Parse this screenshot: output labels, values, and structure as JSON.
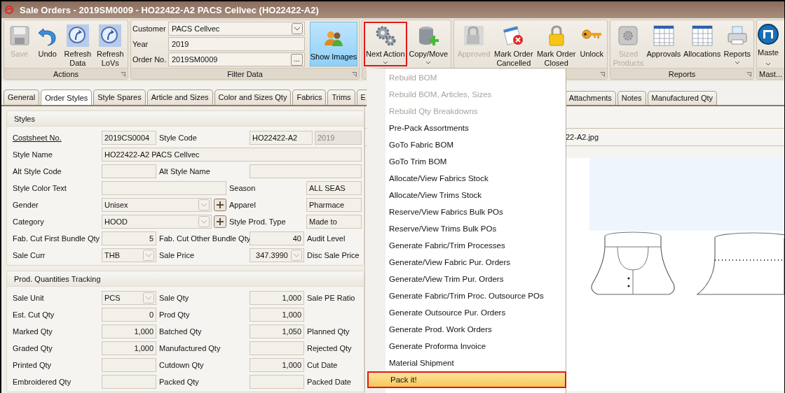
{
  "window": {
    "title": "Sale Orders - 2019SM0009 - HO22422-A2 PACS Cellvec (HO22422-A2)"
  },
  "ribbon": [
    {
      "kind": "buttons",
      "label": "Actions",
      "launcher": true,
      "buttons": [
        {
          "label": "Save",
          "kind": "save",
          "disabled": true,
          "dropdown": false,
          "outlined": false
        },
        {
          "label": "Undo",
          "kind": "undo",
          "disabled": false,
          "dropdown": false,
          "outlined": false
        },
        {
          "label": "Refresh\nData",
          "kind": "refresh",
          "disabled": false,
          "dropdown": false,
          "outlined": false
        },
        {
          "label": "Refresh\nLoVs",
          "kind": "refresh",
          "disabled": false,
          "dropdown": false,
          "outlined": false
        }
      ]
    },
    {
      "kind": "filter",
      "label": "Filter Data",
      "launcher": true,
      "fields": [
        {
          "label": "Customer",
          "value": "PACS Cellvec",
          "kind": "combo"
        },
        {
          "label": "Year",
          "value": "2019",
          "kind": "text"
        },
        {
          "label": "Order No.",
          "value": "2019SM0009",
          "kind": "ellipsis",
          "button": "..."
        }
      ],
      "show_button": {
        "label": "Show Images",
        "kind": "people"
      }
    },
    {
      "kind": "buttons",
      "launcher": false,
      "buttons": [
        {
          "label": "Next Action",
          "kind": "gears",
          "disabled": false,
          "dropdown": true,
          "outlined": true
        },
        {
          "label": "Copy/Move",
          "kind": "database",
          "disabled": false,
          "dropdown": true,
          "outlined": false
        }
      ]
    },
    {
      "kind": "buttons",
      "launcher": true,
      "buttons": [
        {
          "label": "Approved",
          "kind": "padlock-grey",
          "disabled": true,
          "dropdown": false,
          "outlined": false
        },
        {
          "label": "Mark Order\nCancelled",
          "kind": "calendar-cancel",
          "disabled": false,
          "dropdown": false,
          "outlined": false
        },
        {
          "label": "Mark Order\nClosed",
          "kind": "padlock",
          "disabled": false,
          "dropdown": false,
          "outlined": false
        },
        {
          "label": "Unlock",
          "kind": "key",
          "disabled": false,
          "dropdown": false,
          "outlined": false
        }
      ]
    },
    {
      "kind": "buttons",
      "label": "Reports",
      "launcher": true,
      "buttons": [
        {
          "label": "Sized\nProducts",
          "kind": "gear-box",
          "disabled": true,
          "dropdown": false,
          "outlined": false
        },
        {
          "label": "Approvals",
          "kind": "grid",
          "disabled": false,
          "dropdown": false,
          "outlined": false
        },
        {
          "label": "Allocations",
          "kind": "grid",
          "disabled": false,
          "dropdown": false,
          "outlined": false
        },
        {
          "label": "Reports",
          "kind": "printer",
          "disabled": false,
          "dropdown": true,
          "outlined": false
        }
      ]
    },
    {
      "kind": "buttons",
      "label": "Mast...",
      "launcher": false,
      "buttons": [
        {
          "label": "Maste",
          "kind": "round-logo",
          "disabled": false,
          "dropdown": true,
          "outlined": false
        }
      ]
    }
  ],
  "tabs": [
    {
      "label": "General",
      "selected": false
    },
    {
      "label": "Order Styles",
      "selected": true
    },
    {
      "label": "Style Spares",
      "selected": false
    },
    {
      "label": "Article and Sizes",
      "selected": false
    },
    {
      "label": "Color and Sizes Qty",
      "selected": false
    },
    {
      "label": "Fabrics",
      "selected": false
    },
    {
      "label": "Trims",
      "selected": false
    },
    {
      "label": "E",
      "selected": false
    }
  ],
  "more_tabs": [
    {
      "label": "Attachments",
      "selected": false
    },
    {
      "label": "Notes",
      "selected": false
    },
    {
      "label": "Manufactured Qty",
      "selected": false
    }
  ],
  "sections": [
    {
      "title": "Styles",
      "rows": [
        {
          "fields": [
            {
              "kind": "link",
              "text": "Costsheet No."
            },
            {
              "kind": "field",
              "value": "2019CS0004"
            },
            {
              "kind": "label",
              "text": "Style Code"
            },
            {
              "kind": "field",
              "value": "HO22422-A2"
            },
            {
              "kind": "disabled-field",
              "value": "2019"
            }
          ]
        },
        {
          "fields": [
            {
              "kind": "label",
              "text": "Style Name"
            },
            {
              "kind": "field",
              "value": "HO22422-A2 PACS Cellvec"
            }
          ]
        },
        {
          "fields": [
            {
              "kind": "label",
              "text": "Alt Style Code"
            },
            {
              "kind": "field"
            },
            {
              "kind": "label",
              "text": "Alt Style Name"
            },
            {
              "kind": "field"
            }
          ]
        },
        {
          "fields": [
            {
              "kind": "label",
              "text": "Style Color Text"
            },
            {
              "kind": "field"
            },
            {
              "kind": "label",
              "text": "Season"
            },
            {
              "kind": "field",
              "value": "ALL SEAS"
            }
          ]
        },
        {
          "fields": [
            {
              "kind": "label",
              "text": "Gender"
            },
            {
              "kind": "combo",
              "value": "Unisex"
            },
            {
              "kind": "add-button"
            },
            {
              "kind": "label",
              "text": "Apparel"
            },
            {
              "kind": "field",
              "value": "Pharmace"
            }
          ]
        },
        {
          "fields": [
            {
              "kind": "label",
              "text": "Category"
            },
            {
              "kind": "combo",
              "value": "HOOD"
            },
            {
              "kind": "add-button"
            },
            {
              "kind": "label",
              "text": "Style Prod. Type"
            },
            {
              "kind": "field",
              "value": "Made to"
            }
          ]
        },
        {
          "fields": [
            {
              "kind": "label",
              "text": "Fab. Cut First Bundle Qty"
            },
            {
              "kind": "number",
              "value": "5"
            },
            {
              "kind": "label",
              "text": "Fab. Cut Other Bundle Qty"
            },
            {
              "kind": "number",
              "value": "40"
            },
            {
              "kind": "label",
              "text": "Audit Level"
            }
          ]
        },
        {
          "fields": [
            {
              "kind": "label",
              "text": "Sale Curr"
            },
            {
              "kind": "combo",
              "value": "THB"
            },
            {
              "kind": "label",
              "text": "Sale Price"
            },
            {
              "kind": "number-combo",
              "value": "347.3990"
            },
            {
              "kind": "label",
              "text": "Disc Sale Price"
            }
          ]
        }
      ]
    },
    {
      "title": "Prod. Quantities Tracking",
      "rows": [
        {
          "fields": [
            {
              "kind": "label",
              "text": "Sale Unit"
            },
            {
              "kind": "combo",
              "value": "PCS"
            },
            {
              "kind": "label",
              "text": "Sale Qty"
            },
            {
              "kind": "number",
              "value": "1,000"
            },
            {
              "kind": "label",
              "text": "Sale PE Ratio"
            }
          ]
        },
        {
          "fields": [
            {
              "kind": "label",
              "text": "Est. Cut Qty"
            },
            {
              "kind": "number",
              "value": "0"
            },
            {
              "kind": "label",
              "text": "Prod Qty"
            },
            {
              "kind": "number",
              "value": "1,000"
            }
          ]
        },
        {
          "fields": [
            {
              "kind": "label",
              "text": "Marked Qty"
            },
            {
              "kind": "number",
              "value": "1,000"
            },
            {
              "kind": "label",
              "text": "Batched Qty"
            },
            {
              "kind": "number",
              "value": "1,050"
            },
            {
              "kind": "label",
              "text": "Planned Qty"
            }
          ]
        },
        {
          "fields": [
            {
              "kind": "label",
              "text": "Graded Qty"
            },
            {
              "kind": "number",
              "value": "1,000"
            },
            {
              "kind": "label",
              "text": "Manufactured Qty"
            },
            {
              "kind": "number"
            },
            {
              "kind": "label",
              "text": "Rejected Qty"
            }
          ]
        },
        {
          "fields": [
            {
              "kind": "label",
              "text": "Printed Qty"
            },
            {
              "kind": "number"
            },
            {
              "kind": "label",
              "text": "Cutdown Qty"
            },
            {
              "kind": "number",
              "value": "1,000"
            },
            {
              "kind": "label",
              "text": "Cut Date"
            }
          ]
        },
        {
          "fields": [
            {
              "kind": "label",
              "text": "Embroidered Qty"
            },
            {
              "kind": "number"
            },
            {
              "kind": "label",
              "text": "Packed Qty"
            },
            {
              "kind": "number"
            },
            {
              "kind": "label",
              "text": "Packed Date"
            }
          ]
        }
      ]
    }
  ],
  "image_panel": {
    "file_name": "22-A2.jpg"
  },
  "next_action_menu": {
    "items": [
      {
        "label": "Rebuild BOM",
        "disabled": true,
        "selected": false,
        "outlined": false
      },
      {
        "label": "Rebuild BOM, Articles, Sizes",
        "disabled": true,
        "selected": false,
        "outlined": false
      },
      {
        "label": "Rebuild Qty Breakdowns",
        "disabled": true,
        "selected": false,
        "outlined": false
      },
      {
        "label": "Pre-Pack Assortments",
        "disabled": false,
        "selected": false,
        "outlined": false
      },
      {
        "label": "GoTo Fabric BOM",
        "disabled": false,
        "selected": false,
        "outlined": false
      },
      {
        "label": "GoTo Trim BOM",
        "disabled": false,
        "selected": false,
        "outlined": false
      },
      {
        "label": "Allocate/View Fabrics Stock",
        "disabled": false,
        "selected": false,
        "outlined": false
      },
      {
        "label": "Allocate/View Trims Stock",
        "disabled": false,
        "selected": false,
        "outlined": false
      },
      {
        "label": "Reserve/View Fabrics Bulk POs",
        "disabled": false,
        "selected": false,
        "outlined": false
      },
      {
        "label": "Reserve/View Trims Bulk POs",
        "disabled": false,
        "selected": false,
        "outlined": false
      },
      {
        "label": "Generate Fabric/Trim Processes",
        "disabled": false,
        "selected": false,
        "outlined": false
      },
      {
        "label": "Generate/View Fabric Pur. Orders",
        "disabled": false,
        "selected": false,
        "outlined": false
      },
      {
        "label": "Generate/View Trim Pur. Orders",
        "disabled": false,
        "selected": false,
        "outlined": false
      },
      {
        "label": "Generate Fabric/Trim Proc. Outsource POs",
        "disabled": false,
        "selected": false,
        "outlined": false
      },
      {
        "label": "Generate Outsource Pur. Orders",
        "disabled": false,
        "selected": false,
        "outlined": false
      },
      {
        "label": "Generate Prod. Work Orders",
        "disabled": false,
        "selected": false,
        "outlined": false
      },
      {
        "label": "Generate Proforma Invoice",
        "disabled": false,
        "selected": false,
        "outlined": false
      },
      {
        "label": "Material Shipment",
        "disabled": false,
        "selected": false,
        "outlined": false
      },
      {
        "label": "Pack it!",
        "disabled": false,
        "selected": true,
        "outlined": true
      }
    ]
  }
}
